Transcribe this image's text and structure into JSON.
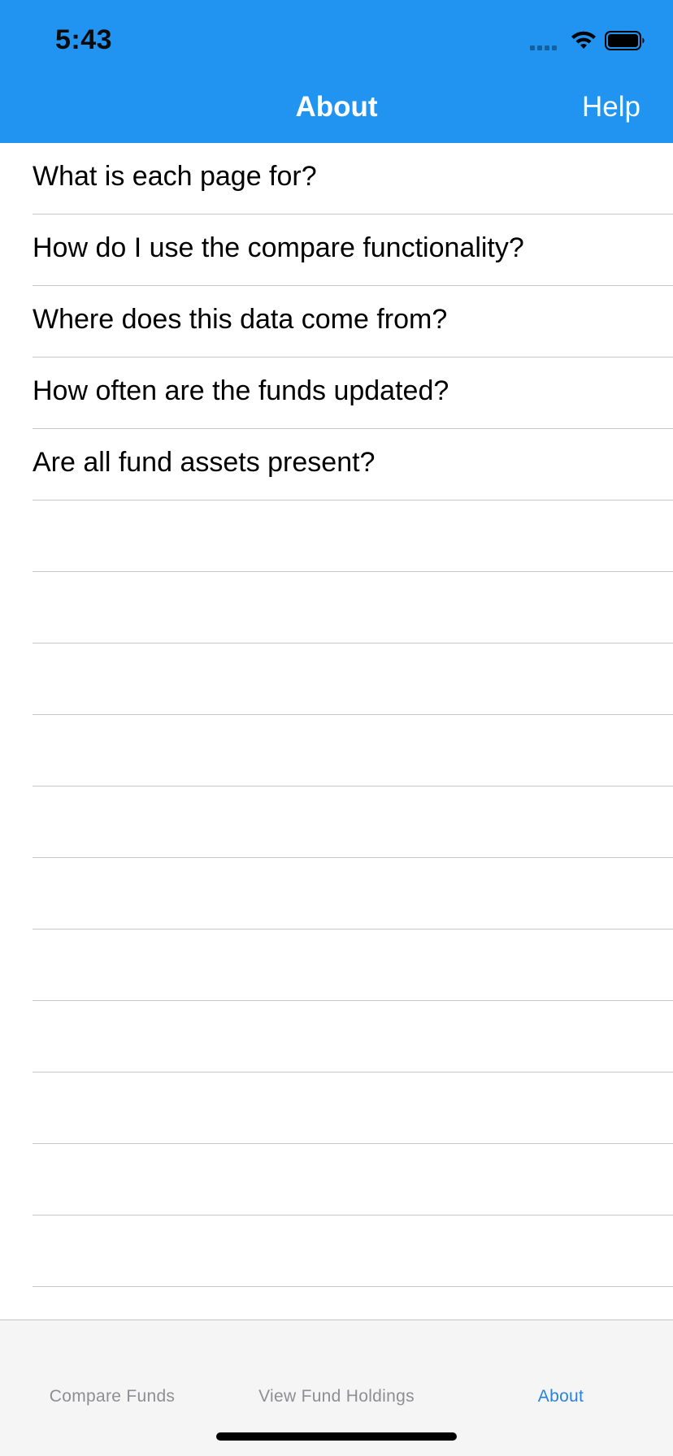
{
  "status_bar": {
    "time": "5:43",
    "icons": [
      "cellular-signal-icon",
      "wifi-icon",
      "battery-icon"
    ]
  },
  "nav": {
    "title": "About",
    "help_label": "Help"
  },
  "colors": {
    "header_background": "#2193f0",
    "active_tab": "#2882e0",
    "inactive_tab": "#8e8e93"
  },
  "list": {
    "items": [
      {
        "label": "What is each page for?"
      },
      {
        "label": "How do I use the compare functionality?"
      },
      {
        "label": "Where does this data come from?"
      },
      {
        "label": "How often are the funds updated?"
      },
      {
        "label": "Are all fund assets present?"
      }
    ]
  },
  "tabs": [
    {
      "label": "Compare Funds",
      "active": false
    },
    {
      "label": "View Fund Holdings",
      "active": false
    },
    {
      "label": "About",
      "active": true
    }
  ]
}
